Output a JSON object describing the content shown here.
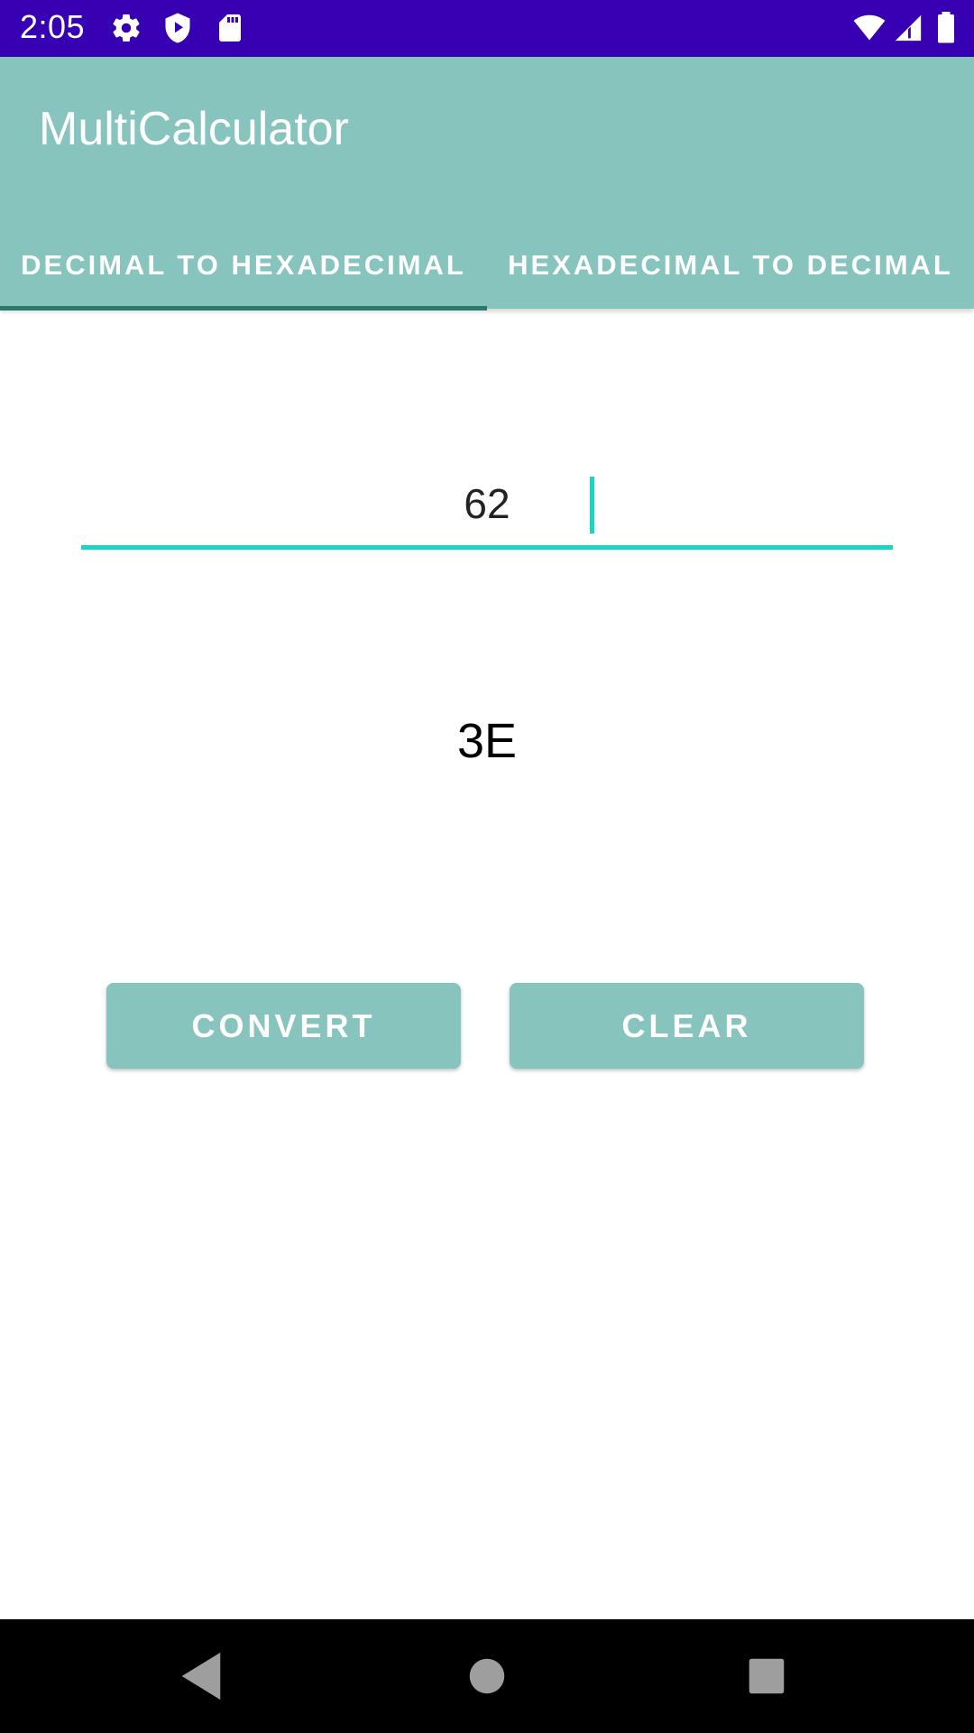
{
  "status_bar": {
    "time": "2:05",
    "icons": [
      "settings-icon",
      "shield-play-icon",
      "sd-card-icon",
      "wifi-icon",
      "signal-icon",
      "battery-icon"
    ],
    "background": "#3700b3"
  },
  "app_bar": {
    "title": "MultiCalculator",
    "background": "#86c4bd",
    "tabs": [
      {
        "label": "DECIMAL TO HEXADECIMAL",
        "selected": true
      },
      {
        "label": "HEXADECIMAL TO DECIMAL",
        "selected": false
      }
    ],
    "indicator_color": "#2a7a6e"
  },
  "converter": {
    "input_value": "62",
    "result": "3E",
    "accent": "#1ad5c4"
  },
  "buttons": {
    "convert_label": "CONVERT",
    "clear_label": "CLEAR"
  },
  "nav_bar": {
    "icons": [
      "back-icon",
      "home-icon",
      "recents-icon"
    ]
  }
}
